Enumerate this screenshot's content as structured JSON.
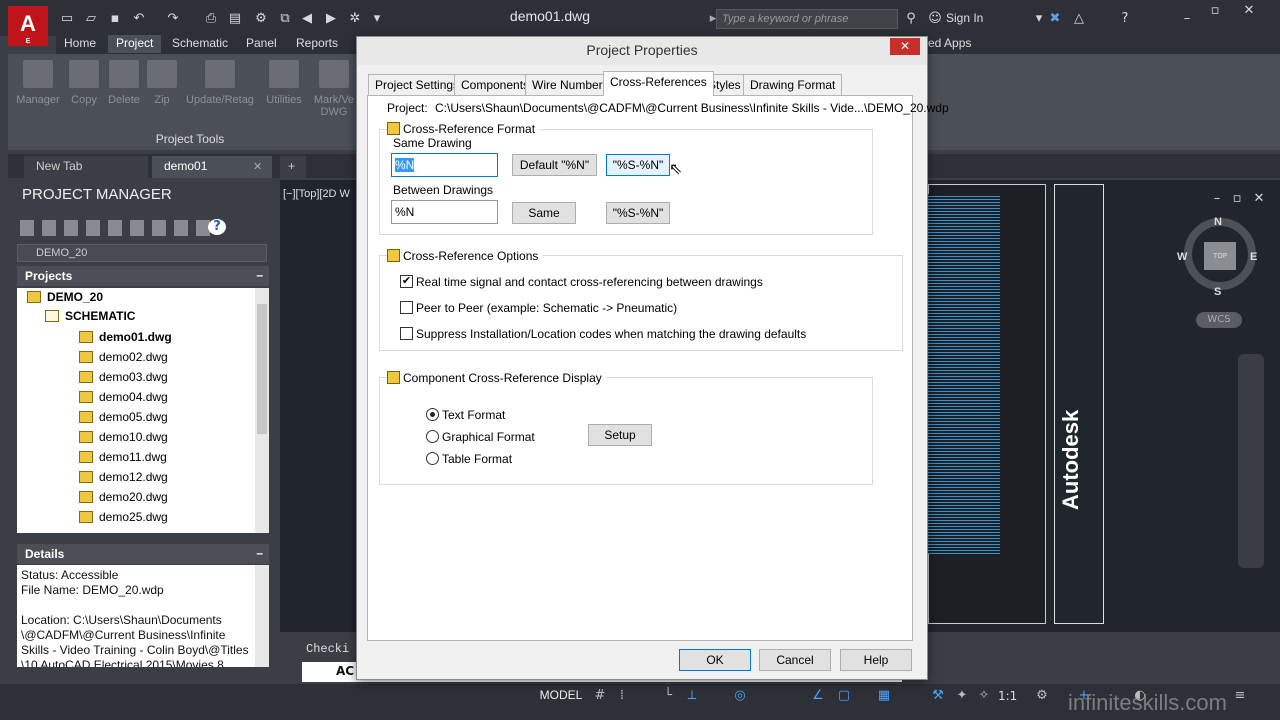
{
  "app": {
    "logo_letter": "A",
    "logo_sub": "E",
    "document_title": "demo01.dwg",
    "search_placeholder": "Type a keyword or phrase",
    "sign_in": "Sign In"
  },
  "ribbon": {
    "tabs": [
      "Home",
      "Project",
      "Schematic",
      "Panel",
      "Reports",
      "ed Apps"
    ],
    "active_tab": "Project",
    "buttons": [
      "Manager",
      "Copy",
      "Delete",
      "Zip",
      "Update/Retag",
      "Utilities",
      "Mark/Ve",
      "DWG"
    ],
    "panel_label": "Project Tools"
  },
  "file_tabs": [
    "New Tab",
    "demo01",
    "+"
  ],
  "project_manager": {
    "title": "PROJECT MANAGER",
    "project_combo": "DEMO_20",
    "projects_header": "Projects",
    "tree": {
      "project": "DEMO_20",
      "folder": "SCHEMATIC",
      "files": [
        "demo01.dwg",
        "demo02.dwg",
        "demo03.dwg",
        "demo04.dwg",
        "demo05.dwg",
        "demo10.dwg",
        "demo11.dwg",
        "demo12.dwg",
        "demo20.dwg",
        "demo25.dwg"
      ]
    },
    "details_header": "Details",
    "details_lines": [
      "Status: Accessible",
      "File Name: DEMO_20.wdp",
      "",
      "Location: C:\\Users\\Shaun\\Documents",
      "\\@CADFM\\@Current Business\\Infinite",
      "Skills - Video Training - Colin Boyd\\@Titles",
      "\\10 AutoCAD Electrical 2015\\Movies 8"
    ]
  },
  "viewport": {
    "label": "[−][Top][2D W",
    "viewcube": {
      "top": "TOP",
      "n": "N",
      "s": "S",
      "e": "E",
      "w": "W"
    },
    "wcs": "WCS",
    "titleblock_text": "Autodesk",
    "command_tab": "Checki",
    "command_prefix": "AC"
  },
  "statusbar": {
    "model": "MODEL",
    "scale": "1:1",
    "watermark": "infiniteskills.com"
  },
  "dialog": {
    "title": "Project Properties",
    "close": "✕",
    "tabs": [
      "Project Settings",
      "Components",
      "Wire Numbers",
      "Cross-References",
      "Styles",
      "Drawing Format"
    ],
    "active_tab": "Cross-References",
    "project_label": "Project:",
    "project_path": "C:\\Users\\Shaun\\Documents\\@CADFM\\@Current Business\\Infinite Skills - Vide...\\DEMO_20.wdp",
    "xref_format": {
      "title": "Cross-Reference Format",
      "same_label": "Same Drawing",
      "same_value": "%N",
      "btn_default": "Default \"%N\"",
      "btn_s_n_1": "\"%S-%N\"",
      "between_label": "Between Drawings",
      "between_value": "%N",
      "btn_same": "Same",
      "btn_s_n_2": "\"%S-%N\""
    },
    "xref_options": {
      "title": "Cross-Reference Options",
      "items": [
        {
          "label": "Real time signal and contact cross-referencing between drawings",
          "checked": true
        },
        {
          "label": "Peer to Peer (example: Schematic -> Pneumatic)",
          "checked": false
        },
        {
          "label": "Suppress Installation/Location codes when matching the drawing defaults",
          "checked": false
        }
      ]
    },
    "component_display": {
      "title": "Component Cross-Reference Display",
      "options": [
        {
          "label": "Text Format",
          "selected": true
        },
        {
          "label": "Graphical Format",
          "selected": false
        },
        {
          "label": "Table Format",
          "selected": false
        }
      ],
      "setup_button": "Setup"
    },
    "buttons": {
      "ok": "OK",
      "cancel": "Cancel",
      "help": "Help"
    }
  }
}
